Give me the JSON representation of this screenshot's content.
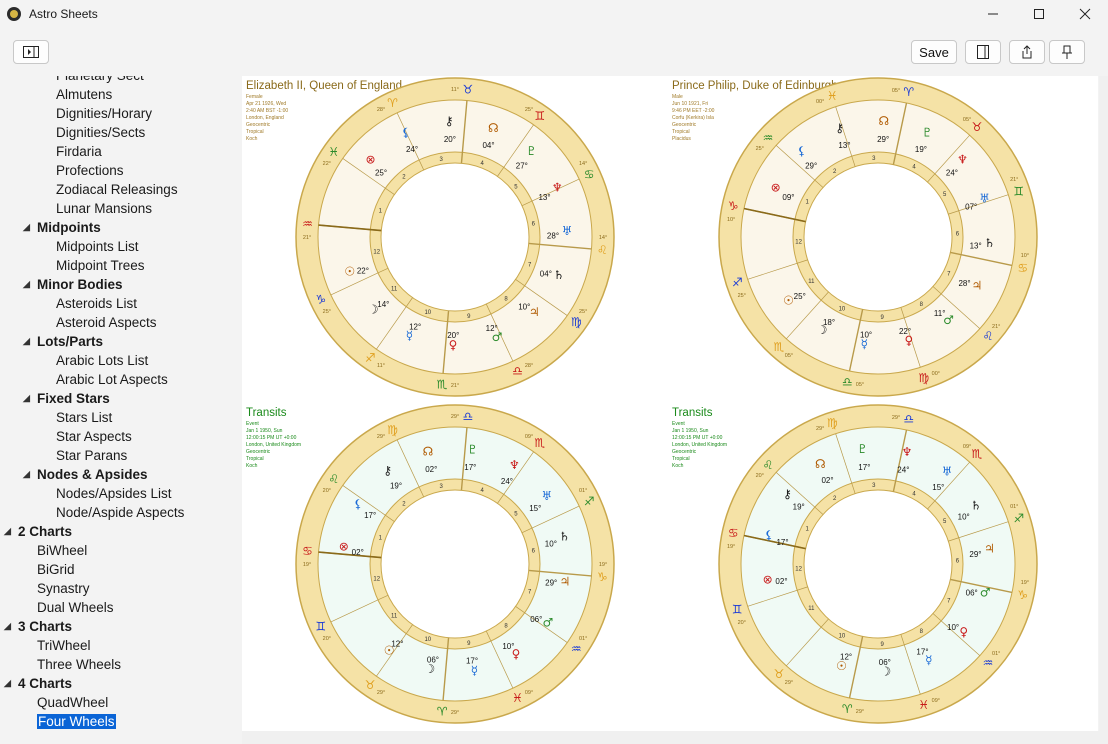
{
  "window": {
    "title": "Astro Sheets"
  },
  "toolbar": {
    "save_label": "Save"
  },
  "sidebar": {
    "items": [
      {
        "label": "Planetary Sect",
        "level": 2
      },
      {
        "label": "Almutens",
        "level": 2
      },
      {
        "label": "Dignities/Horary",
        "level": 2
      },
      {
        "label": "Dignities/Sects",
        "level": 2
      },
      {
        "label": "Firdaria",
        "level": 2
      },
      {
        "label": "Profections",
        "level": 2
      },
      {
        "label": "Zodiacal Releasings",
        "level": 2
      },
      {
        "label": "Lunar Mansions",
        "level": 2
      },
      {
        "label": "Midpoints",
        "level": 1,
        "group": true
      },
      {
        "label": "Midpoints List",
        "level": 2
      },
      {
        "label": "Midpoint Trees",
        "level": 2
      },
      {
        "label": "Minor Bodies",
        "level": 1,
        "group": true
      },
      {
        "label": "Asteroids List",
        "level": 2
      },
      {
        "label": "Asteroid Aspects",
        "level": 2
      },
      {
        "label": "Lots/Parts",
        "level": 1,
        "group": true
      },
      {
        "label": "Arabic Lots List",
        "level": 2
      },
      {
        "label": "Arabic Lot Aspects",
        "level": 2
      },
      {
        "label": "Fixed Stars",
        "level": 1,
        "group": true
      },
      {
        "label": "Stars List",
        "level": 2
      },
      {
        "label": "Star Aspects",
        "level": 2
      },
      {
        "label": "Star Parans",
        "level": 2
      },
      {
        "label": "Nodes & Apsides",
        "level": 1,
        "group": true
      },
      {
        "label": "Nodes/Apsides List",
        "level": 2
      },
      {
        "label": "Node/Aspide Aspects",
        "level": 2
      },
      {
        "label": "2 Charts",
        "level": 0,
        "group": true
      },
      {
        "label": "BiWheel",
        "level": 1
      },
      {
        "label": "BiGrid",
        "level": 1
      },
      {
        "label": "Synastry",
        "level": 1
      },
      {
        "label": "Dual Wheels",
        "level": 1
      },
      {
        "label": "3 Charts",
        "level": 0,
        "group": true
      },
      {
        "label": "TriWheel",
        "level": 1
      },
      {
        "label": "Three Wheels",
        "level": 1
      },
      {
        "label": "4 Charts",
        "level": 0,
        "group": true
      },
      {
        "label": "QuadWheel",
        "level": 1
      },
      {
        "label": "Four Wheels",
        "level": 1,
        "selected": true
      }
    ]
  },
  "charts": [
    {
      "name": "Elizabeth II, Queen of England",
      "info": [
        "Female",
        "Apr 21 1926, Wed",
        "2:40 AM BST -1:00",
        "London, England",
        "Geocentric",
        "Tropical",
        "Koch"
      ],
      "name_color": "#8a6a1a",
      "info_color": "#a07a28",
      "fill": "#fbf6ea",
      "signs": [
        "♒",
        "♓",
        "♈",
        "♉",
        "♊",
        "♋",
        "♌",
        "♍",
        "♎",
        "♏",
        "♐",
        "♑"
      ],
      "cusp_labels": [
        "21°",
        "22°",
        "28°",
        "11°",
        "25°",
        "14°",
        "14°",
        "25°",
        "28°",
        "21°",
        "11°",
        "25°"
      ],
      "houses": [
        "1",
        "2",
        "3",
        "4",
        "5",
        "6",
        "7",
        "8",
        "9",
        "10",
        "11",
        "12"
      ],
      "planets": [
        "22°",
        "14°",
        "12°",
        "20°",
        "12°",
        "10°",
        "04°",
        "28°",
        "13°",
        "27°",
        "04°",
        "20°",
        "24°",
        "25°"
      ]
    },
    {
      "name": "Prince Philip, Duke of Edinburgh",
      "info": [
        "Male",
        "Jun 10 1921, Fri",
        "9:46 PM EET -2:00",
        "Corfu (Kerkira) Isla",
        "Geocentric",
        "Tropical",
        "Placidus"
      ],
      "name_color": "#8a6a1a",
      "info_color": "#a07a28",
      "fill": "#fbf6ea",
      "signs": [
        "♑",
        "♒",
        "♓",
        "♈",
        "♉",
        "♊",
        "♋",
        "♌",
        "♍",
        "♎",
        "♏",
        "♐"
      ],
      "cusp_labels": [
        "10°",
        "25°",
        "00°",
        "05°",
        "05°",
        "21°",
        "10°",
        "21°",
        "00°",
        "05°",
        "05°",
        "25°"
      ],
      "houses": [
        "1",
        "2",
        "3",
        "4",
        "5",
        "6",
        "7",
        "8",
        "9",
        "10",
        "11",
        "12"
      ],
      "planets": [
        "25°",
        "18°",
        "10°",
        "22°",
        "11°",
        "28°",
        "13°",
        "07°",
        "24°",
        "19°",
        "29°",
        "13°",
        "29°",
        "09°"
      ]
    },
    {
      "name": "Transits",
      "info": [
        "Event",
        "Jan 1 1950, Sun",
        "12:00:15 PM UT +0:00",
        "London, United Kingdom",
        "Geocentric",
        "Tropical",
        "Koch"
      ],
      "name_color": "#1a8a1a",
      "info_color": "#1a8a1a",
      "fill": "#f0faf5",
      "signs": [
        "♋",
        "♌",
        "♍",
        "♎",
        "♏",
        "♐",
        "♑",
        "♒",
        "♓",
        "♈",
        "♉",
        "♊"
      ],
      "cusp_labels": [
        "19°",
        "20°",
        "29°",
        "29°",
        "09°",
        "01°",
        "19°",
        "01°",
        "09°",
        "29°",
        "29°",
        "20°"
      ],
      "houses": [
        "1",
        "2",
        "3",
        "4",
        "5",
        "6",
        "7",
        "8",
        "9",
        "10",
        "11",
        "12"
      ],
      "planets": [
        "12°",
        "06°",
        "17°",
        "10°",
        "06°",
        "29°",
        "10°",
        "15°",
        "24°",
        "17°",
        "02°",
        "19°",
        "17°",
        "02°"
      ]
    },
    {
      "name": "Transits",
      "info": [
        "Event",
        "Jan 1 1950, Sun",
        "12:00:15 PM UT +0:00",
        "London, United Kingdom",
        "Geocentric",
        "Tropical",
        "Koch"
      ],
      "name_color": "#1a8a1a",
      "info_color": "#1a8a1a",
      "fill": "#f0faf5",
      "signs": [
        "♋",
        "♌",
        "♍",
        "♎",
        "♏",
        "♐",
        "♑",
        "♒",
        "♓",
        "♈",
        "♉",
        "♊"
      ],
      "cusp_labels": [
        "19°",
        "20°",
        "29°",
        "29°",
        "09°",
        "01°",
        "19°",
        "01°",
        "09°",
        "29°",
        "29°",
        "20°"
      ],
      "houses": [
        "1",
        "2",
        "3",
        "4",
        "5",
        "6",
        "7",
        "8",
        "9",
        "10",
        "11",
        "12"
      ],
      "planets": [
        "12°",
        "06°",
        "17°",
        "10°",
        "06°",
        "29°",
        "10°",
        "15°",
        "24°",
        "17°",
        "02°",
        "19°",
        "17°",
        "02°"
      ]
    }
  ]
}
